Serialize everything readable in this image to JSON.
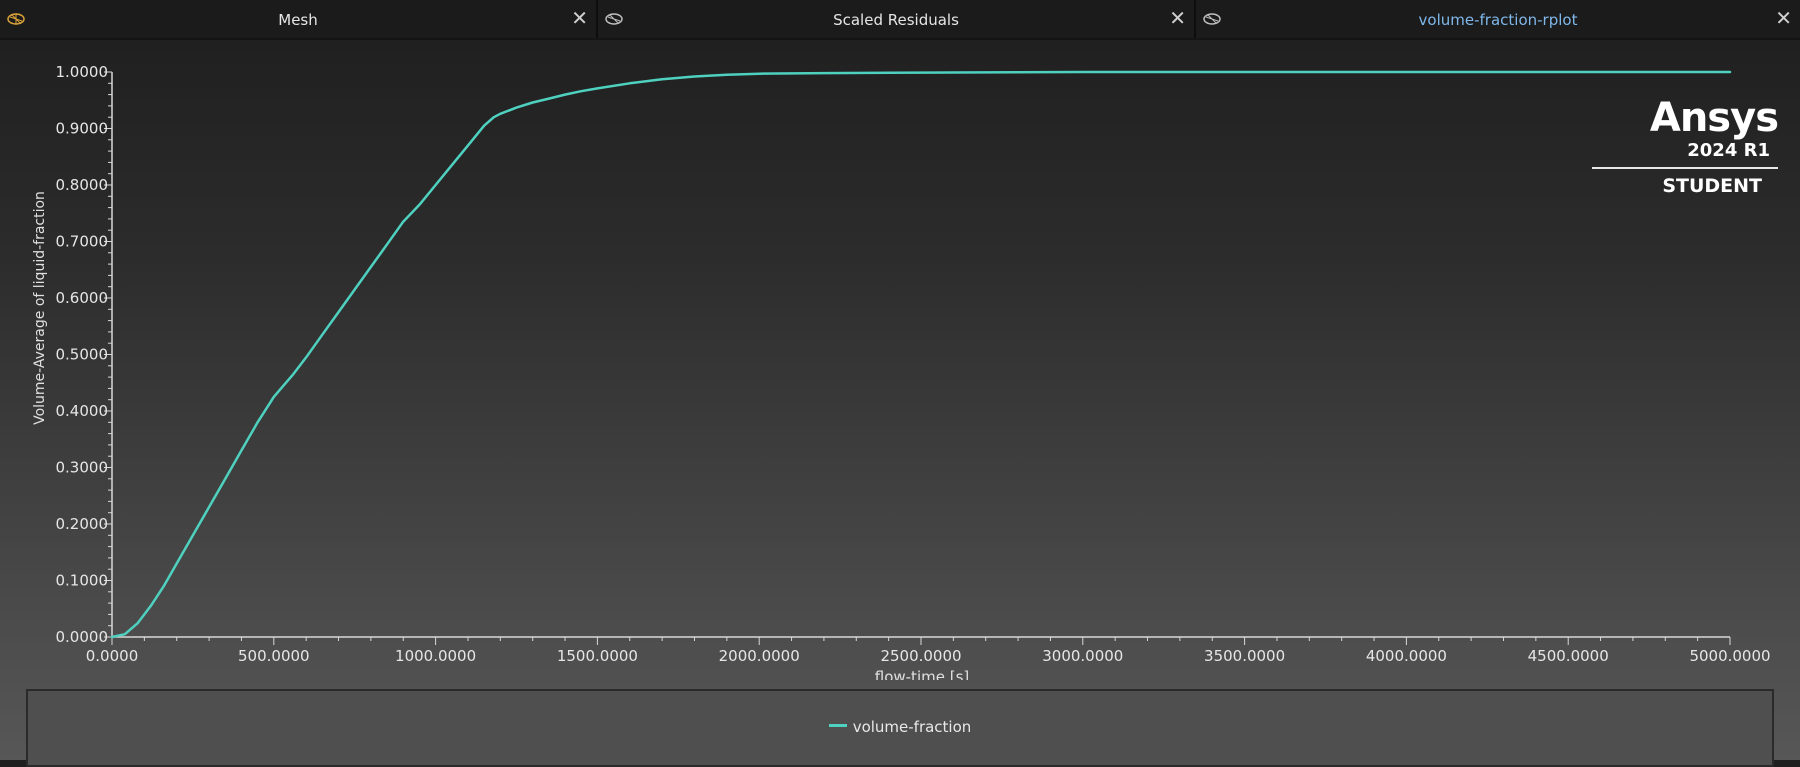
{
  "tabs": [
    {
      "label": "Mesh",
      "icon": "mesh-icon",
      "active": false
    },
    {
      "label": "Scaled Residuals",
      "icon": "residuals-icon",
      "active": false
    },
    {
      "label": "volume-fraction-rplot",
      "icon": "plot-icon",
      "active": true
    }
  ],
  "close_glyph": "✕",
  "logo": {
    "brand": "Ansys",
    "release": "2024 R1",
    "edition": "STUDENT"
  },
  "colors": {
    "series": "#4fd1c0",
    "active_tab_text": "#7fb7ea",
    "axis": "#d8d8d8"
  },
  "chart_data": {
    "type": "line",
    "xlabel": "flow-time [s]",
    "ylabel": "Volume-Average of liquid-fraction",
    "xlim": [
      0,
      5000
    ],
    "ylim": [
      0,
      1
    ],
    "x_ticks": [
      "0.0000",
      "500.0000",
      "1000.0000",
      "1500.0000",
      "2000.0000",
      "2500.0000",
      "3000.0000",
      "3500.0000",
      "4000.0000",
      "4500.0000",
      "5000.0000"
    ],
    "y_ticks": [
      "0.0000",
      "0.1000",
      "0.2000",
      "0.3000",
      "0.4000",
      "0.5000",
      "0.6000",
      "0.7000",
      "0.8000",
      "0.9000",
      "1.0000"
    ],
    "legend_position": "bottom",
    "series": [
      {
        "name": "volume-fraction",
        "x": [
          0,
          40,
          80,
          120,
          160,
          200,
          250,
          300,
          350,
          400,
          450,
          500,
          530,
          560,
          600,
          650,
          700,
          750,
          800,
          850,
          900,
          950,
          1000,
          1050,
          1100,
          1150,
          1180,
          1200,
          1250,
          1300,
          1350,
          1400,
          1450,
          1500,
          1600,
          1700,
          1800,
          1900,
          2000,
          2200,
          2500,
          3000,
          3500,
          4000,
          4500,
          5000
        ],
        "y": [
          0,
          0.005,
          0.025,
          0.055,
          0.09,
          0.13,
          0.18,
          0.23,
          0.28,
          0.33,
          0.38,
          0.425,
          0.445,
          0.465,
          0.495,
          0.535,
          0.575,
          0.615,
          0.655,
          0.695,
          0.735,
          0.765,
          0.8,
          0.835,
          0.87,
          0.905,
          0.92,
          0.926,
          0.937,
          0.946,
          0.953,
          0.96,
          0.966,
          0.971,
          0.98,
          0.987,
          0.992,
          0.995,
          0.997,
          0.998,
          0.999,
          1.0,
          1.0,
          1.0,
          1.0,
          1.0
        ]
      }
    ]
  }
}
